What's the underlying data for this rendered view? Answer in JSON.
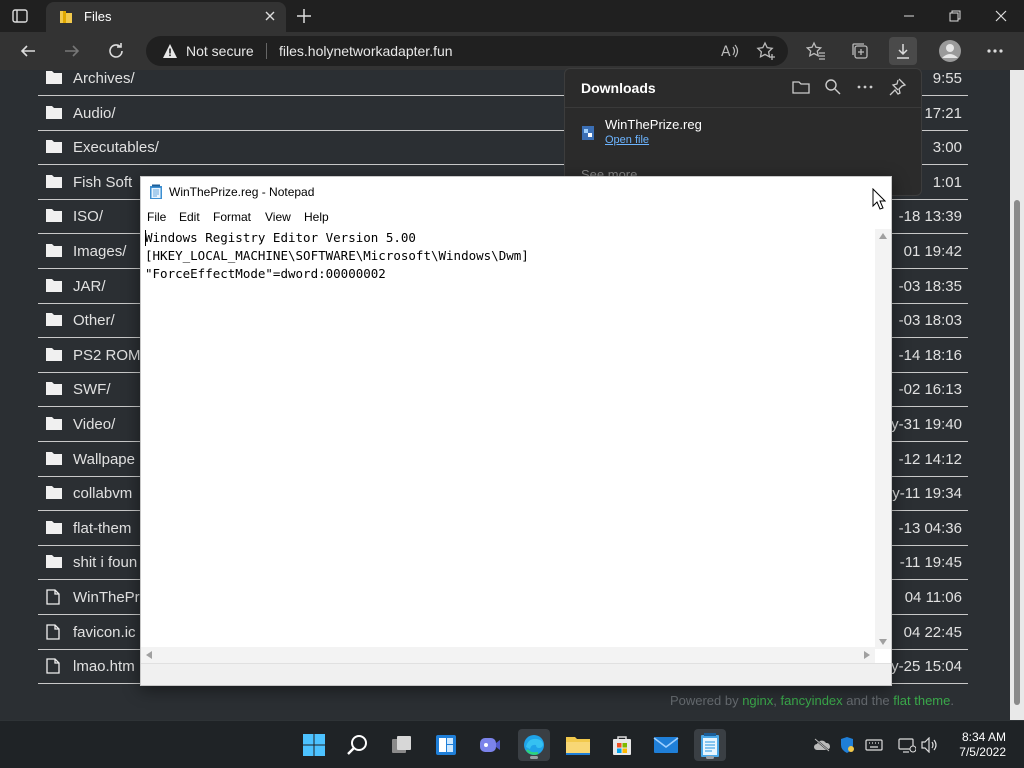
{
  "browser": {
    "tab": {
      "title": "Files"
    },
    "address": {
      "security": "Not secure",
      "url": "files.holynetworkadapter.fun"
    }
  },
  "listing": {
    "rows": [
      {
        "name": "Archives/",
        "date": "9:55",
        "type": "folder"
      },
      {
        "name": "Audio/",
        "date": "17:21",
        "type": "folder"
      },
      {
        "name": "Executables/",
        "date": "3:00",
        "type": "folder"
      },
      {
        "name": "Fish Soft",
        "date": "1:01",
        "type": "folder"
      },
      {
        "name": "ISO/",
        "date": "-18 13:39",
        "type": "folder"
      },
      {
        "name": "Images/",
        "date": "01 19:42",
        "type": "folder"
      },
      {
        "name": "JAR/",
        "date": "-03 18:35",
        "type": "folder"
      },
      {
        "name": "Other/",
        "date": "-03 18:03",
        "type": "folder"
      },
      {
        "name": "PS2 ROM",
        "date": "-14 18:16",
        "type": "folder"
      },
      {
        "name": "SWF/",
        "date": "-02 16:13",
        "type": "folder"
      },
      {
        "name": "Video/",
        "date": "y-31 19:40",
        "type": "folder"
      },
      {
        "name": "Wallpape",
        "date": "-12 14:12",
        "type": "folder"
      },
      {
        "name": "collabvm",
        "date": "y-11 19:34",
        "type": "folder"
      },
      {
        "name": "flat-them",
        "date": "-13 04:36",
        "type": "folder"
      },
      {
        "name": "shit i foun",
        "date": "-11 19:45",
        "type": "folder"
      },
      {
        "name": "WinThePr",
        "date": "04 11:06",
        "type": "file"
      },
      {
        "name": "favicon.ic",
        "date": "04 22:45",
        "type": "file"
      },
      {
        "name": "lmao.htm",
        "date": "y-25 15:04",
        "type": "file"
      }
    ],
    "footer": {
      "prefix": "Powered by ",
      "link1": "nginx",
      "sep1": ", ",
      "link2": "fancyindex",
      "sep2": " and the ",
      "link3": "flat theme",
      "suffix": "."
    }
  },
  "downloads": {
    "title": "Downloads",
    "item": {
      "filename": "WinThePrize.reg",
      "action": "Open file"
    },
    "see_more": "See more"
  },
  "notepad": {
    "title": "WinThePrize.reg - Notepad",
    "menu": [
      "File",
      "Edit",
      "Format",
      "View",
      "Help"
    ],
    "lines": [
      "Windows Registry Editor Version 5.00",
      "",
      "[HKEY_LOCAL_MACHINE\\SOFTWARE\\Microsoft\\Windows\\Dwm]",
      "\"ForceEffectMode\"=dword:00000002"
    ]
  },
  "taskbar": {
    "clock": {
      "time": "8:34 AM",
      "date": "7/5/2022"
    }
  },
  "colors": {
    "page_bg": "#2b2f33",
    "accent_link": "#3aa84a",
    "taskbar": "#1f2326"
  }
}
